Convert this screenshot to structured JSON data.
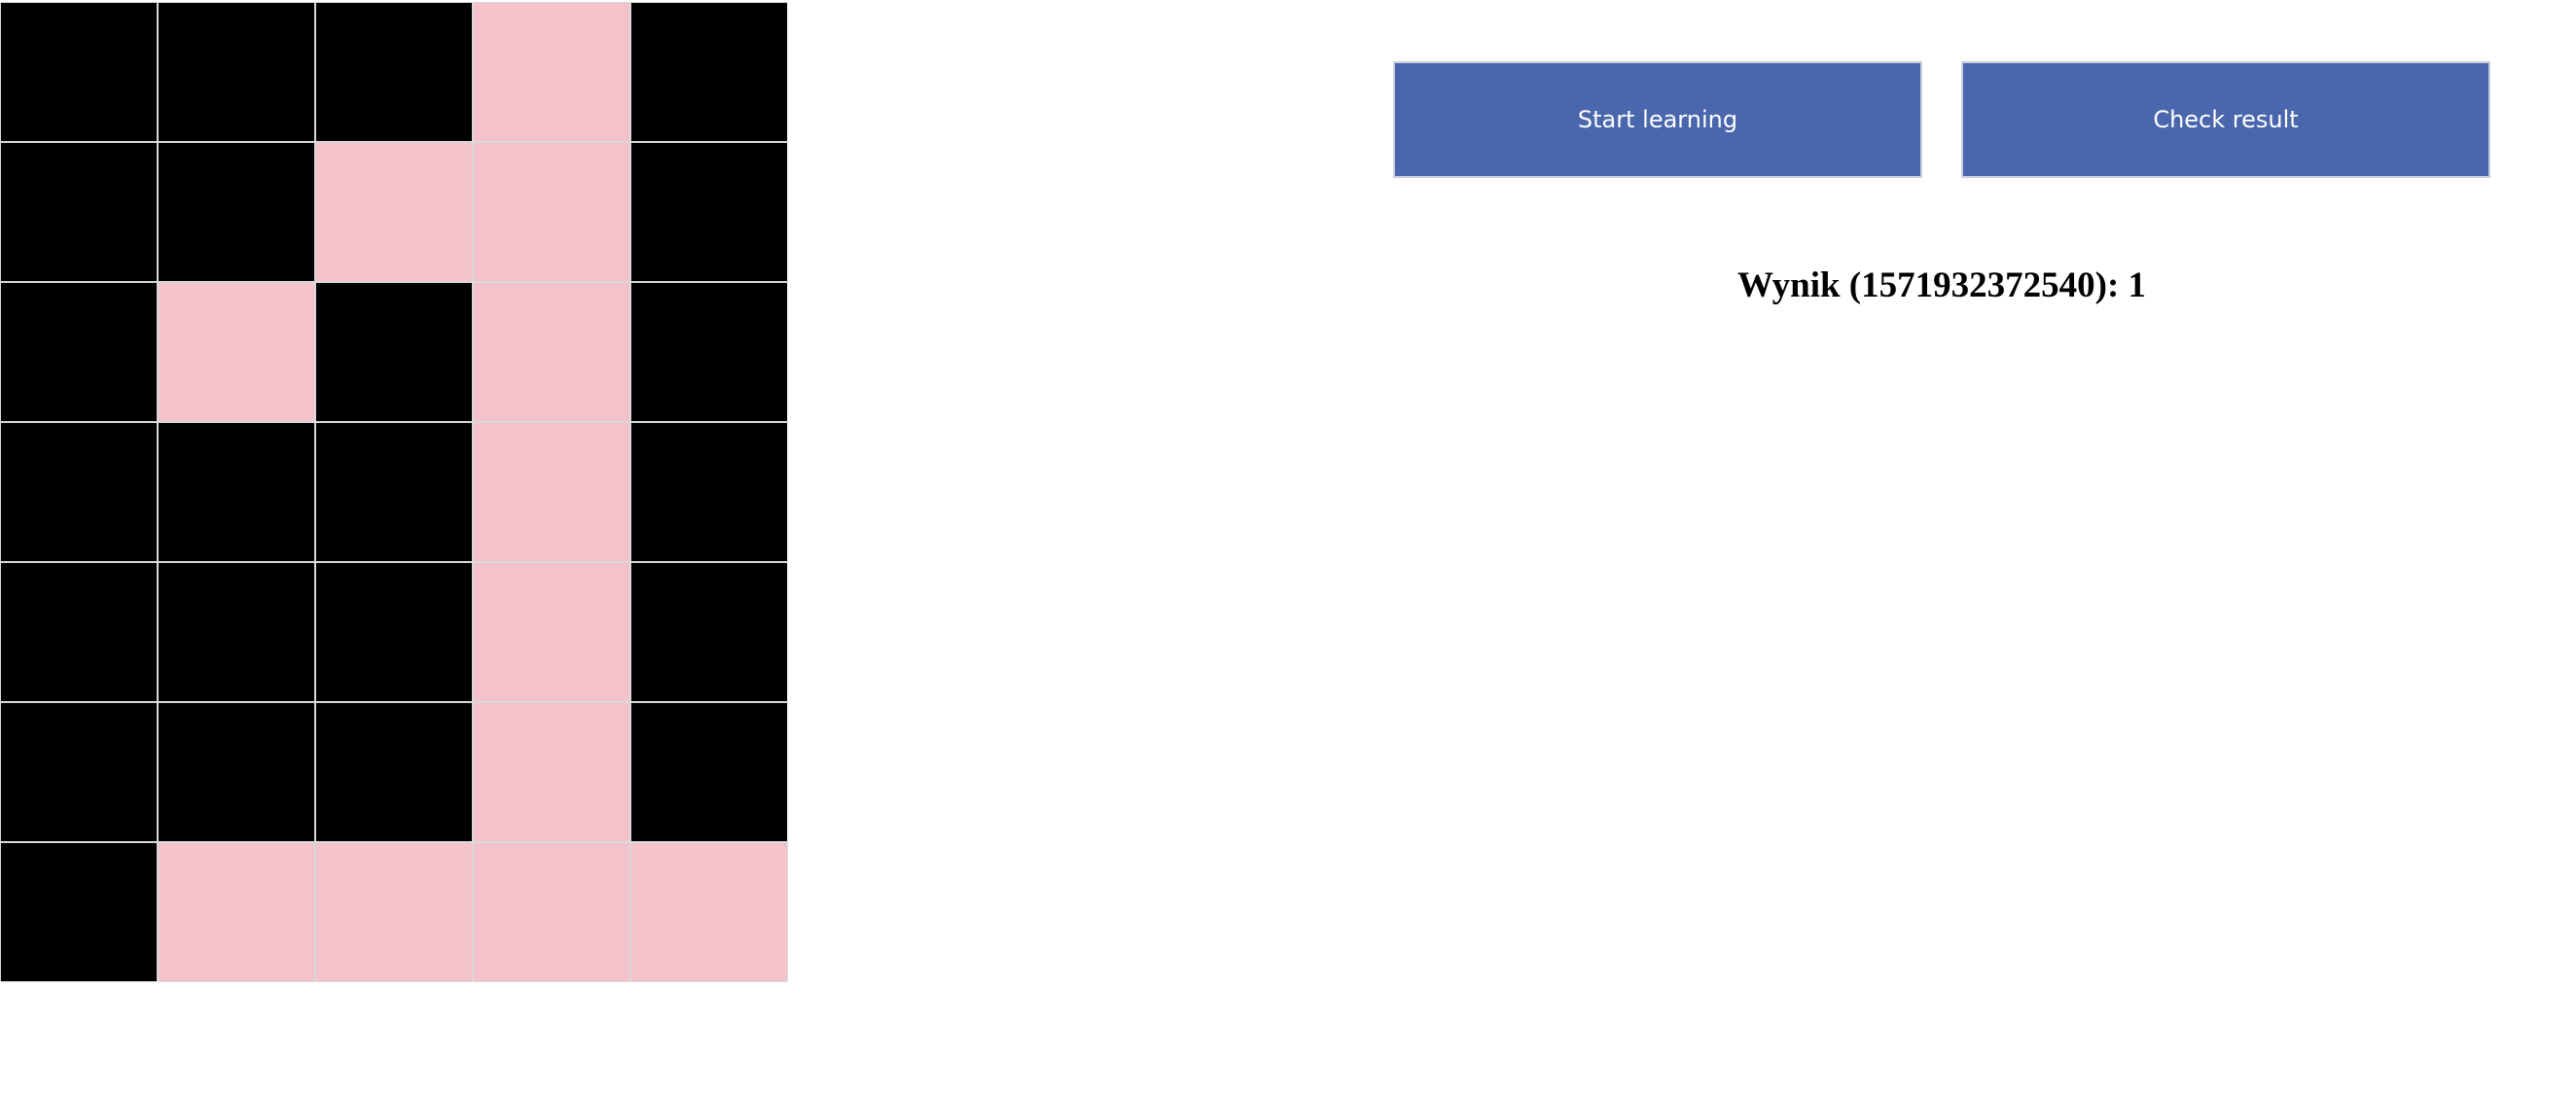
{
  "grid": {
    "rows": 7,
    "cols": 5,
    "cells": [
      [
        0,
        0,
        0,
        1,
        0
      ],
      [
        0,
        0,
        1,
        1,
        0
      ],
      [
        0,
        1,
        0,
        1,
        0
      ],
      [
        0,
        0,
        0,
        1,
        0
      ],
      [
        0,
        0,
        0,
        1,
        0
      ],
      [
        0,
        0,
        0,
        1,
        0
      ],
      [
        0,
        1,
        1,
        1,
        1
      ]
    ],
    "colors": {
      "on": "#f4c2cb",
      "off": "#000000"
    }
  },
  "buttons": {
    "start_label": "Start learning",
    "check_label": "Check result",
    "color": "#4a66ad"
  },
  "result": {
    "text": "Wynik (1571932372540): 1"
  }
}
